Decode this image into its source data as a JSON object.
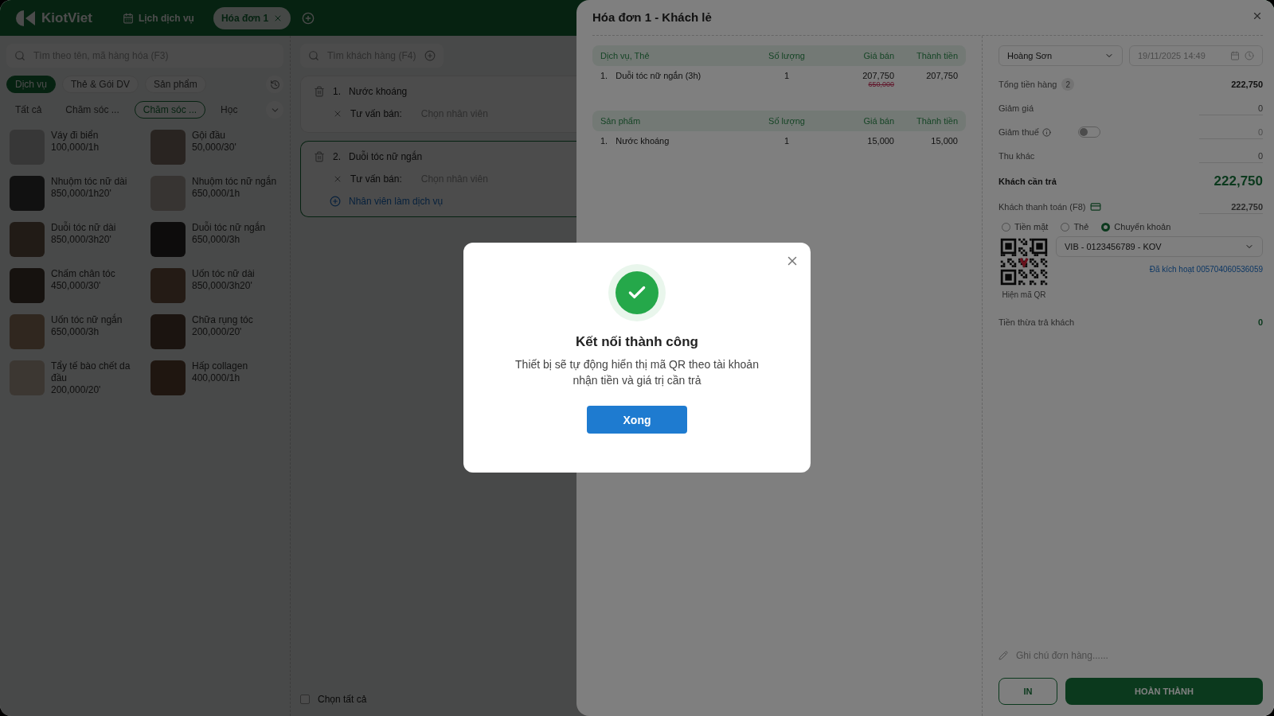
{
  "header": {
    "logo": "KiotViet",
    "tabs": [
      {
        "label": "Lịch dịch vụ",
        "kind": "calendar",
        "selected": false
      },
      {
        "label": "Hóa đơn 1",
        "kind": "invoice",
        "selected": true
      }
    ]
  },
  "product_search": {
    "placeholder": "Tìm theo tên, mã hàng hóa (F3)"
  },
  "type_tabs": [
    {
      "label": "Dịch vụ",
      "selected": true
    },
    {
      "label": "Thẻ & Gói DV",
      "selected": false
    },
    {
      "label": "Sản phẩm",
      "selected": false
    }
  ],
  "categories": [
    {
      "label": "Tất cả",
      "selected": false
    },
    {
      "label": "Chăm sóc ...",
      "selected": false
    },
    {
      "label": "Chăm sóc ...",
      "selected": true
    },
    {
      "label": "Học",
      "selected": false
    }
  ],
  "products": [
    {
      "name": "Váy đi biển",
      "price": "100,000/1h"
    },
    {
      "name": "Gội đầu",
      "price": "50,000/30'"
    },
    {
      "name": "Nhuộm tóc nữ dài",
      "price": "850,000/1h20'"
    },
    {
      "name": "Nhuộm tóc nữ ngắn",
      "price": "650,000/1h"
    },
    {
      "name": "Duỗi tóc nữ dài",
      "price": "850,000/3h20'"
    },
    {
      "name": "Duỗi tóc nữ ngắn",
      "price": "650,000/3h"
    },
    {
      "name": "Chấm chân tóc",
      "price": "450,000/30'"
    },
    {
      "name": "Uốn tóc nữ dài",
      "price": "850,000/3h20'"
    },
    {
      "name": "Uốn tóc nữ ngắn",
      "price": "650,000/3h"
    },
    {
      "name": "Chữa rụng tóc",
      "price": "200,000/20'"
    },
    {
      "name": "Tẩy tế bào chết da đầu",
      "price": "200,000/20'"
    },
    {
      "name": "Hấp collagen",
      "price": "400,000/1h"
    }
  ],
  "customer_search": {
    "placeholder": "Tìm khách hàng (F4)"
  },
  "cart_items": [
    {
      "index": "1.",
      "name": "Nước khoáng",
      "advisor_label": "Tư vấn bán:",
      "advisor_placeholder": "Chọn nhân viên",
      "selected": false
    },
    {
      "index": "2.",
      "name": "Duỗi tóc nữ ngắn",
      "advisor_label": "Tư vấn bán:",
      "advisor_placeholder": "Chọn nhân viên",
      "add_staff": "Nhân viên làm dịch vụ",
      "selected": true
    }
  ],
  "select_all": {
    "label": "Chọn tất cả",
    "checked": false
  },
  "invoice": {
    "title": "Hóa đơn 1 - Khách lẻ",
    "sections": [
      {
        "columns": [
          "Dịch vụ, Thẻ",
          "Số lượng",
          "Giá bán",
          "Thành tiền"
        ],
        "rows": [
          {
            "index": "1.",
            "name": "Duỗi tóc nữ ngắn (3h)",
            "quantity": "1",
            "price": "207,750",
            "original_price": "650,000",
            "total": "207,750"
          }
        ]
      },
      {
        "columns": [
          "Sản phẩm",
          "Số lượng",
          "Giá bán",
          "Thành tiền"
        ],
        "rows": [
          {
            "index": "1.",
            "name": "Nước khoáng",
            "quantity": "1",
            "price": "15,000",
            "total": "15,000"
          }
        ]
      }
    ]
  },
  "payment": {
    "staff": "Hoàng Sơn",
    "datetime": "19/11/2025 14:49",
    "subtotal_label": "Tổng tiền hàng",
    "item_count": "2",
    "subtotal": "222,750",
    "discount": {
      "label": "Giảm giá",
      "value": "0"
    },
    "tax": {
      "label": "Giảm thuế",
      "on": false,
      "value": "0"
    },
    "other": {
      "label": "Thu khác",
      "value": "0"
    },
    "due_label": "Khách cần trả",
    "due": "222,750",
    "paid_label": "Khách thanh toán (F8)",
    "paid": "222,750",
    "methods": [
      {
        "label": "Tiền mặt",
        "selected": false
      },
      {
        "label": "Thẻ",
        "selected": false
      },
      {
        "label": "Chuyển khoản",
        "selected": true
      }
    ],
    "bank_account": "VIB - 0123456789 - KOV",
    "qr_caption": "Hiện mã QR",
    "activated": "Đã kích hoạt 005704060536059",
    "change_label": "Tiền thừa trả khách",
    "change": "0",
    "note_placeholder": "Ghi chú đơn hàng......",
    "print_button": "IN",
    "complete_button": "HOÀN THÀNH"
  },
  "dialog": {
    "title": "Kết nối thành công",
    "message": "Thiết bị sẽ tự động hiển thị mã QR theo tài khoản nhận tiền và giá trị cần trả",
    "button": "Xong"
  }
}
